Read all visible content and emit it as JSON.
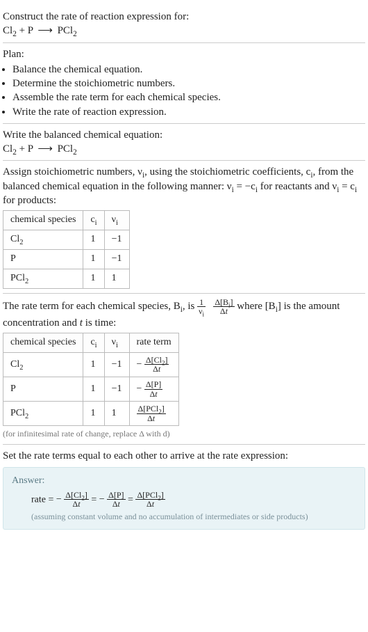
{
  "prompt_title": "Construct the rate of reaction expression for:",
  "equation_html": "Cl<sub>2</sub> + P <span class='arrow'>⟶</span> PCl<sub>2</sub>",
  "plan": {
    "label": "Plan:",
    "items": [
      "Balance the chemical equation.",
      "Determine the stoichiometric numbers.",
      "Assemble the rate term for each chemical species.",
      "Write the rate of reaction expression."
    ]
  },
  "balance": {
    "intro": "Write the balanced chemical equation:",
    "equation_html": "Cl<sub>2</sub> + P <span class='arrow'>⟶</span> PCl<sub>2</sub>"
  },
  "stoich": {
    "intro_html": "Assign stoichiometric numbers, ν<sub>i</sub>, using the stoichiometric coefficients, c<sub>i</sub>, from the balanced chemical equation in the following manner: ν<sub>i</sub> = −c<sub>i</sub> for reactants and ν<sub>i</sub> = c<sub>i</sub> for products:",
    "headers": {
      "species": "chemical species",
      "c": "c<sub>i</sub>",
      "nu": "ν<sub>i</sub>"
    },
    "rows": [
      {
        "species_html": "Cl<sub>2</sub>",
        "c": "1",
        "nu": "−1"
      },
      {
        "species_html": "P",
        "c": "1",
        "nu": "−1"
      },
      {
        "species_html": "PCl<sub>2</sub>",
        "c": "1",
        "nu": "1"
      }
    ]
  },
  "rateterm": {
    "intro_pre_html": "The rate term for each chemical species, B<sub>i</sub>, is ",
    "intro_post_html": " where [B<sub>i</sub>] is the amount concentration and <i>t</i> is time:",
    "frac1_num": "1",
    "frac1_den_html": "ν<sub>i</sub>",
    "frac2_num_html": "Δ[B<sub>i</sub>]",
    "frac2_den_html": "Δ<i>t</i>",
    "headers": {
      "species": "chemical species",
      "c": "c<sub>i</sub>",
      "nu": "ν<sub>i</sub>",
      "rate": "rate term"
    },
    "rows": [
      {
        "species_html": "Cl<sub>2</sub>",
        "c": "1",
        "nu": "−1",
        "rate_num_html": "Δ[Cl<sub>2</sub>]",
        "rate_den_html": "Δ<i>t</i>",
        "neg": "−"
      },
      {
        "species_html": "P",
        "c": "1",
        "nu": "−1",
        "rate_num_html": "Δ[P]",
        "rate_den_html": "Δ<i>t</i>",
        "neg": "−"
      },
      {
        "species_html": "PCl<sub>2</sub>",
        "c": "1",
        "nu": "1",
        "rate_num_html": "Δ[PCl<sub>2</sub>]",
        "rate_den_html": "Δ<i>t</i>",
        "neg": ""
      }
    ],
    "note": "(for infinitesimal rate of change, replace Δ with d)"
  },
  "final": {
    "intro": "Set the rate terms equal to each other to arrive at the rate expression:",
    "answer_label": "Answer:",
    "rate_prefix": "rate = ",
    "terms": [
      {
        "neg": "−",
        "num_html": "Δ[Cl<sub>2</sub>]",
        "den_html": "Δ<i>t</i>"
      },
      {
        "neg": "−",
        "num_html": "Δ[P]",
        "den_html": "Δ<i>t</i>"
      },
      {
        "neg": "",
        "num_html": "Δ[PCl<sub>2</sub>]",
        "den_html": "Δ<i>t</i>"
      }
    ],
    "eq": " = ",
    "assume": "(assuming constant volume and no accumulation of intermediates or side products)"
  }
}
